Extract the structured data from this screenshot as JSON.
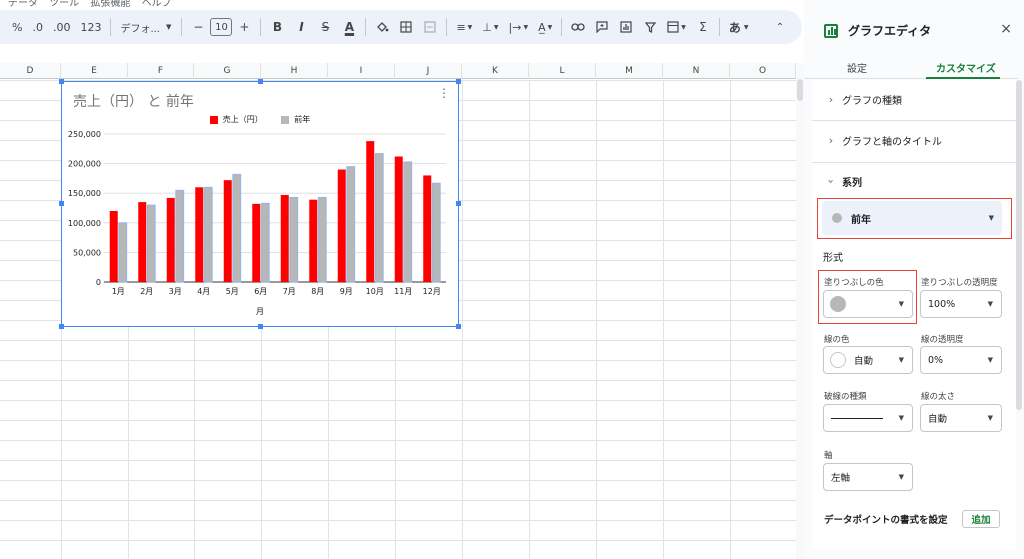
{
  "topmenu": [
    "データ",
    "ツール",
    "拡張機能",
    "ヘルプ"
  ],
  "toolbar": {
    "percent": "%",
    "dec_decrease": ".0",
    "dec_increase": ".00",
    "format_123": "123",
    "font": "デフォ...",
    "font_size": "10",
    "minus": "−",
    "plus": "+",
    "bold": "B",
    "italic": "I",
    "strike": "S",
    "text_color": "A",
    "ja_input": "あ"
  },
  "columns": [
    "D",
    "E",
    "F",
    "G",
    "H",
    "I",
    "J",
    "K",
    "L",
    "M",
    "N",
    "O"
  ],
  "chart": {
    "title": "売上（円） と 前年",
    "x_title": "月"
  },
  "chart_data": {
    "type": "bar",
    "title": "売上（円） と 前年",
    "xlabel": "月",
    "ylabel": "",
    "ylim": [
      0,
      250000
    ],
    "yticks": [
      "0",
      "50,000",
      "100,000",
      "150,000",
      "200,000",
      "250,000"
    ],
    "categories": [
      "1月",
      "2月",
      "3月",
      "4月",
      "5月",
      "6月",
      "7月",
      "8月",
      "9月",
      "10月",
      "11月",
      "12月"
    ],
    "legend_position": "top",
    "grid": true,
    "series": [
      {
        "name": "売上（円）",
        "color": "#ff0000",
        "values": [
          120000,
          135000,
          142000,
          160000,
          172000,
          132000,
          147000,
          139000,
          190000,
          238000,
          212000,
          180000
        ]
      },
      {
        "name": "前年",
        "color": "#b7b7b7",
        "values": [
          100000,
          130000,
          155000,
          160000,
          182000,
          133000,
          143000,
          143000,
          195000,
          217000,
          203000,
          167000
        ]
      }
    ]
  },
  "panel": {
    "title": "グラフエディタ",
    "close": "×",
    "tab_settings": "設定",
    "tab_customize": "カスタマイズ",
    "section_type": "グラフの種類",
    "section_titles": "グラフと軸のタイトル",
    "section_series": "系列",
    "series_selected": "前年",
    "format_heading": "形式",
    "fill_color_label": "塗りつぶしの色",
    "fill_opacity_label": "塗りつぶしの透明度",
    "fill_opacity_value": "100%",
    "line_color_label": "線の色",
    "line_color_value": "自動",
    "line_opacity_label": "線の透明度",
    "line_opacity_value": "0%",
    "dash_label": "破線の種類",
    "line_width_label": "線の太さ",
    "line_width_value": "自動",
    "axis_label": "軸",
    "axis_value": "左軸",
    "datapoint_label": "データポイントの書式を設定",
    "add_label": "追加",
    "fill_color": "#b7b7b7"
  }
}
